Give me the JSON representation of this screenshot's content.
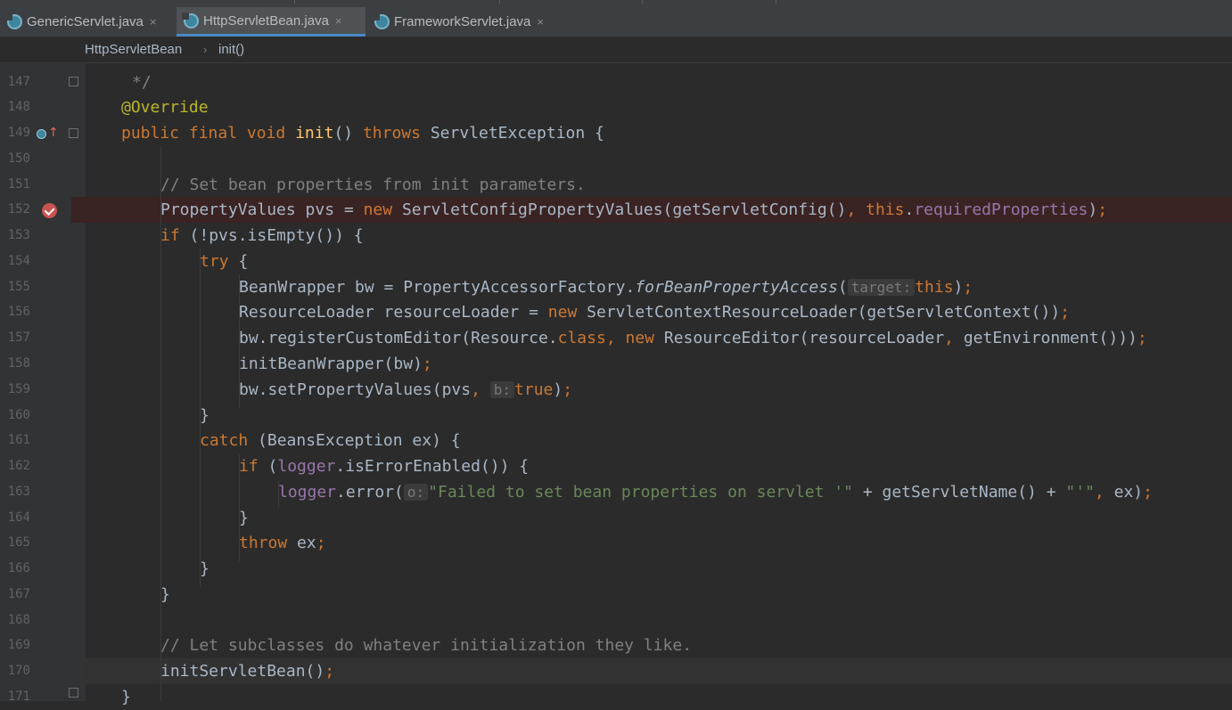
{
  "tabs": [
    {
      "label": "GenericServlet.java",
      "close": "×",
      "active": false
    },
    {
      "label": "HttpServletBean.java",
      "close": "×",
      "active": true
    },
    {
      "label": "FrameworkServlet.java",
      "close": "×",
      "active": false
    }
  ],
  "breadcrumb": {
    "class_name": "HttpServletBean",
    "separator": "›",
    "method": "init()"
  },
  "editor": {
    "line_numbers": [
      "147",
      "148",
      "149",
      "150",
      "151",
      "152",
      "153",
      "154",
      "155",
      "156",
      "157",
      "158",
      "159",
      "160",
      "161",
      "162",
      "163",
      "164",
      "165",
      "166",
      "167",
      "168",
      "169",
      "170",
      "171"
    ],
    "code": {
      "l147": "*/",
      "l148_annotation": "@Override",
      "l149": {
        "kw1": "public final void ",
        "name": "init",
        "paren": "() ",
        "kw2": "throws ",
        "rest": "ServletException {"
      },
      "l151_comment": "// Set bean properties from init parameters.",
      "l152": {
        "a": "PropertyValues pvs = ",
        "kw_new": "new ",
        "b": "ServletConfigPropertyValues(getServletConfig()",
        "comma": ", ",
        "kw_this": "this",
        "dot": ".",
        "field": "requiredProperties",
        "c": ")",
        "semi": ";"
      },
      "l153": {
        "kw": "if ",
        "rest": "(!pvs.isEmpty()) {"
      },
      "l154": {
        "kw": "try ",
        "rest": "{"
      },
      "l155": {
        "a": "BeanWrapper bw = PropertyAccessorFactory.",
        "method": "forBeanPropertyAccess",
        "b": "(",
        "hint": "target:",
        "kw_this": "this",
        "c": ")",
        "semi": ";"
      },
      "l156": {
        "a": "ResourceLoader resourceLoader = ",
        "kw_new": "new ",
        "b": "ServletContextResourceLoader(getServletContext())",
        "semi": ";"
      },
      "l157": {
        "a": "bw.registerCustomEditor(Resource.",
        "kw_class": "class",
        "comma": ", ",
        "kw_new": "new ",
        "b": "ResourceEditor(resourceLoader",
        "comma2": ", ",
        "c": "getEnvironment()))",
        "semi": ";"
      },
      "l158": {
        "a": "initBeanWrapper(bw)",
        "semi": ";"
      },
      "l159": {
        "a": "bw.setPropertyValues(pvs",
        "comma": ", ",
        "hint": "b:",
        "kw_true": "true",
        "b": ")",
        "semi": ";"
      },
      "l160": "}",
      "l161": {
        "kw": "catch ",
        "rest": "(BeansException ex) {"
      },
      "l162": {
        "kw": "if ",
        "a": "(",
        "field": "logger",
        "b": ".isErrorEnabled()) {"
      },
      "l163": {
        "field": "logger",
        "a": ".error(",
        "hint": "o:",
        "str": "\"Failed to set bean properties on servlet '\"",
        "b": " + getServletName() + ",
        "str2": "\"'\"",
        "comma": ", ",
        "c": "ex)",
        "semi": ";"
      },
      "l164": "}",
      "l165": {
        "kw": "throw ",
        "a": "ex",
        "semi": ";"
      },
      "l166": "}",
      "l167": "}",
      "l169_comment": "// Let subclasses do whatever initialization they like.",
      "l170": {
        "a": "initServletBean()",
        "semi": ";"
      },
      "l171": "}"
    }
  }
}
